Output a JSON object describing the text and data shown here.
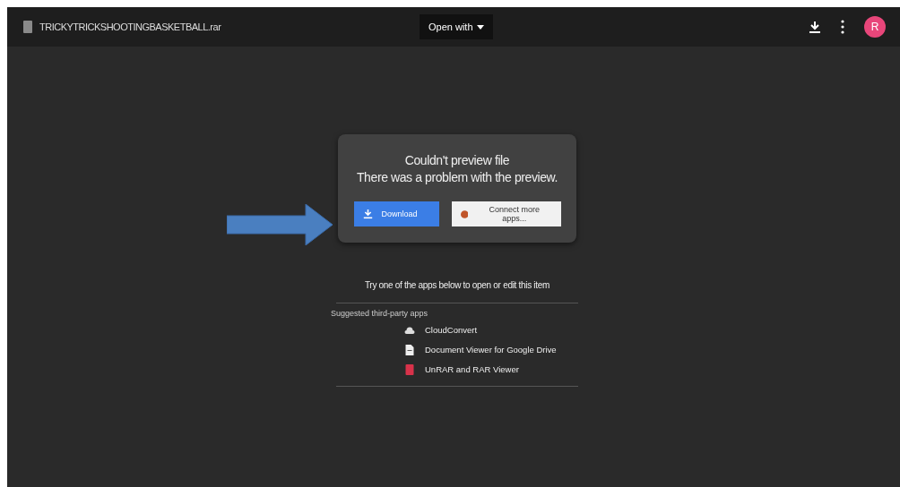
{
  "header": {
    "file_name": "TRICKYTRICKSHOOTINGBASKETBALL.rar",
    "open_with": "Open with",
    "avatar": "R"
  },
  "preview": {
    "title": "Couldn't preview file",
    "message": "There was a problem with the preview.",
    "download": "Download",
    "connect": "Connect more apps..."
  },
  "apps": {
    "prompt": "Try one of the apps below to open or edit this item",
    "heading": "Suggested third-party apps",
    "items": [
      {
        "kind": "cloud",
        "label": "CloudConvert"
      },
      {
        "kind": "doc",
        "label": "Document Viewer for Google Drive"
      },
      {
        "kind": "rar",
        "label": "UnRAR and RAR Viewer"
      }
    ]
  }
}
